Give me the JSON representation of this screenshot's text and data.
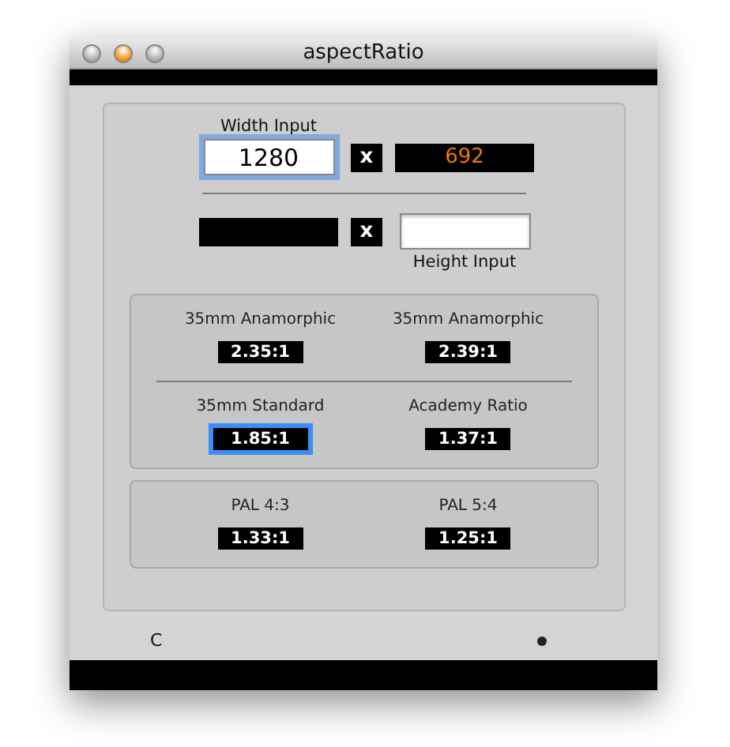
{
  "window": {
    "title": "aspectRatio"
  },
  "width_row": {
    "label": "Width Input",
    "value": "1280",
    "focused": true,
    "times": "x",
    "result": "692"
  },
  "height_row": {
    "times": "x",
    "label": "Height Input",
    "focused": false
  },
  "preset_groups": [
    {
      "rows": [
        [
          {
            "label": "35mm Anamorphic",
            "ratio": "2.35:1",
            "selected": false
          },
          {
            "label": "35mm Anamorphic",
            "ratio": "2.39:1",
            "selected": false
          }
        ],
        [
          {
            "label": "35mm Standard",
            "ratio": "1.85:1",
            "selected": true
          },
          {
            "label": "Academy Ratio",
            "ratio": "1.37:1",
            "selected": false
          }
        ]
      ]
    },
    {
      "rows": [
        [
          {
            "label": "PAL 4:3",
            "ratio": "1.33:1",
            "selected": false
          },
          {
            "label": "PAL 5:4",
            "ratio": "1.25:1",
            "selected": false
          }
        ]
      ]
    }
  ],
  "footer": {
    "left_text": "C"
  }
}
